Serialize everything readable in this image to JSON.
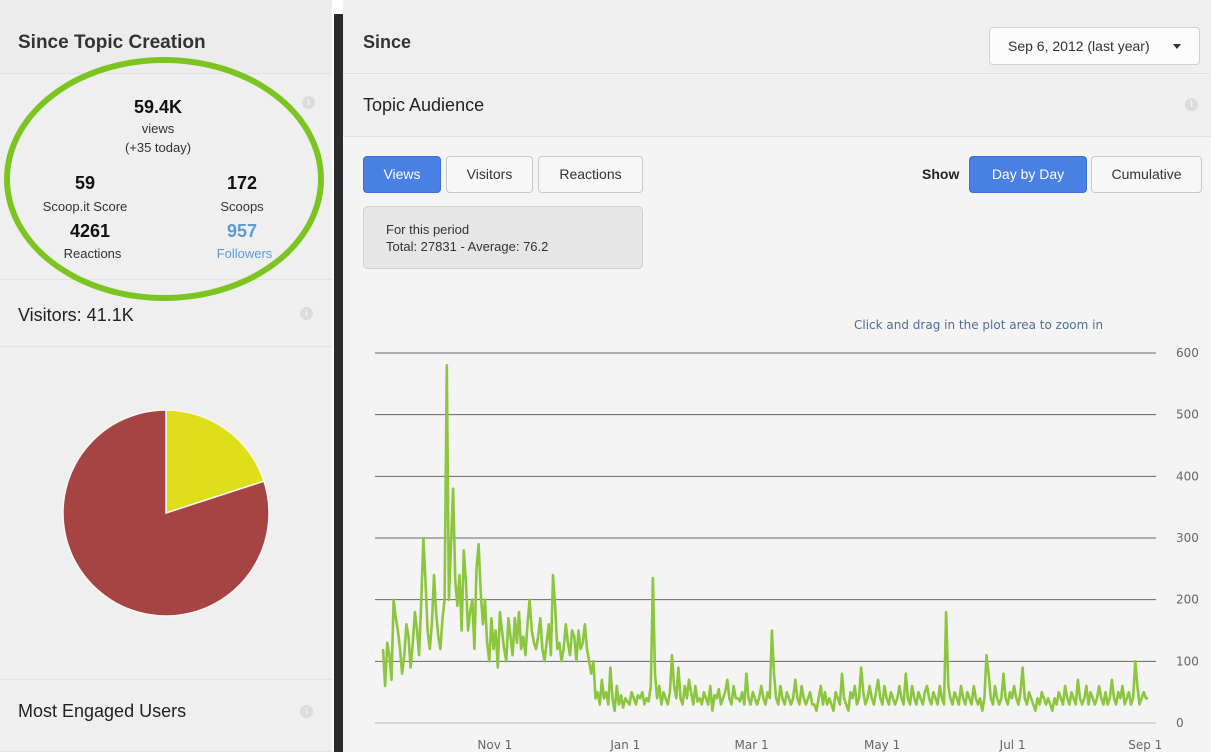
{
  "left": {
    "header_title": "Since Topic Creation",
    "stats": {
      "views_value": "59.4K",
      "views_label": "views",
      "views_today": "(+35 today)",
      "score_value": "59",
      "score_label": "Scoop.it Score",
      "scoops_value": "172",
      "scoops_label": "Scoops",
      "reactions_value": "4261",
      "reactions_label": "Reactions",
      "followers_value": "957",
      "followers_label": "Followers"
    },
    "visitors_title": "Visitors: 41.1K",
    "engaged_title": "Most Engaged Users",
    "info_glyph": "i",
    "pie": {
      "slices": [
        {
          "value": 0.2,
          "color": "#dede1b"
        },
        {
          "value": 0.8,
          "color": "#a64444"
        }
      ]
    }
  },
  "right": {
    "since_title": "Since",
    "date_selected": "Sep 6, 2012 (last year)",
    "audience_title": "Topic Audience",
    "tabs": [
      "Views",
      "Visitors",
      "Reactions"
    ],
    "active_tab": "Views",
    "show_label": "Show",
    "modes": [
      "Day by Day",
      "Cumulative"
    ],
    "active_mode": "Day by Day",
    "period_title": "For this period",
    "period_stats": "Total: 27831 - Average: 76.2",
    "zoom_hint": "Click and drag in the plot area to zoom in"
  },
  "colors": {
    "accent_blue": "#4a7fe3",
    "line_green": "#8cc63f",
    "highlight_ring": "#7cc520",
    "followers_link": "#5b9bd5"
  },
  "chart_data": {
    "type": "line",
    "ylim": [
      0,
      600
    ],
    "yticks": [
      0,
      100,
      200,
      300,
      400,
      500,
      600
    ],
    "xticks": [
      "Nov 1",
      "Jan 1",
      "Mar 1",
      "May 1",
      "Jul 1",
      "Sep 1"
    ],
    "xrange": [
      "2012-09-06",
      "2013-09-06"
    ],
    "series": [
      {
        "values": [
          120,
          60,
          130,
          110,
          70,
          200,
          170,
          150,
          120,
          80,
          110,
          160,
          140,
          90,
          130,
          180,
          150,
          110,
          200,
          300,
          230,
          150,
          120,
          160,
          240,
          180,
          140,
          120,
          170,
          200,
          580,
          200,
          290,
          380,
          230,
          190,
          240,
          150,
          280,
          230,
          150,
          180,
          200,
          120,
          250,
          290,
          210,
          160,
          200,
          130,
          100,
          170,
          120,
          150,
          90,
          180,
          150,
          120,
          100,
          170,
          140,
          110,
          170,
          130,
          180,
          120,
          140,
          110,
          160,
          200,
          150,
          130,
          120,
          140,
          170,
          120,
          100,
          130,
          160,
          110,
          240,
          190,
          120,
          130,
          100,
          120,
          160,
          130,
          110,
          150,
          140,
          100,
          150,
          120,
          130,
          160,
          120,
          100,
          80,
          100,
          40,
          50,
          30,
          70,
          40,
          50,
          30,
          90,
          40,
          20,
          60,
          30,
          45,
          25,
          40,
          35,
          30,
          50,
          40,
          30,
          45,
          40,
          50,
          30,
          40,
          35,
          60,
          235,
          80,
          40,
          60,
          30,
          50,
          40,
          30,
          50,
          110,
          60,
          40,
          90,
          40,
          30,
          60,
          40,
          70,
          50,
          30,
          60,
          35,
          40,
          30,
          50,
          40,
          30,
          60,
          20,
          45,
          40,
          55,
          30,
          40,
          50,
          70,
          40,
          30,
          60,
          40,
          40,
          35,
          50,
          30,
          80,
          40,
          30,
          50,
          40,
          30,
          40,
          60,
          40,
          30,
          50,
          40,
          150,
          80,
          40,
          30,
          60,
          40,
          30,
          50,
          40,
          30,
          40,
          70,
          40,
          30,
          60,
          40,
          30,
          40,
          50,
          30,
          30,
          20,
          40,
          60,
          30,
          50,
          30,
          40,
          30,
          20,
          50,
          40,
          30,
          80,
          40,
          30,
          20,
          50,
          40,
          60,
          30,
          40,
          90,
          50,
          30,
          40,
          60,
          40,
          30,
          50,
          70,
          40,
          30,
          60,
          40,
          30,
          50,
          40,
          30,
          40,
          60,
          40,
          30,
          80,
          40,
          30,
          60,
          40,
          30,
          50,
          40,
          30,
          50,
          60,
          40,
          30,
          50,
          40,
          30,
          60,
          40,
          30,
          180,
          60,
          40,
          30,
          50,
          40,
          30,
          60,
          40,
          30,
          50,
          40,
          30,
          60,
          40,
          30,
          40,
          20,
          40,
          110,
          80,
          40,
          30,
          60,
          40,
          30,
          40,
          80,
          40,
          30,
          50,
          40,
          60,
          40,
          30,
          50,
          90,
          40,
          30,
          50,
          40,
          30,
          20,
          40,
          30,
          50,
          40,
          30,
          40,
          30,
          20,
          40,
          30,
          50,
          40,
          30,
          60,
          40,
          30,
          50,
          40,
          30,
          70,
          40,
          30,
          40,
          60,
          30,
          50,
          40,
          30,
          40,
          60,
          40,
          30,
          50,
          30,
          40,
          70,
          40,
          30,
          50,
          40,
          60,
          30,
          40,
          50,
          30,
          40,
          100,
          60,
          30,
          40,
          50,
          40,
          40
        ]
      }
    ]
  }
}
